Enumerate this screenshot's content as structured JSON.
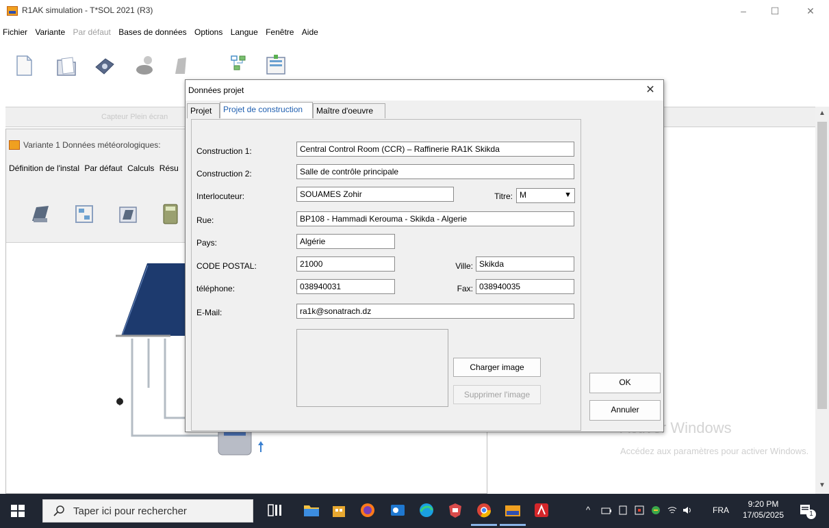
{
  "app": {
    "title": "R1AK simulation - T*SOL 2021 (R3)",
    "controls": {
      "minimize": "–",
      "maximize": "☐",
      "close": "✕"
    }
  },
  "menu": [
    "Fichier",
    "Variante",
    "Par défaut",
    "Bases de données",
    "Options",
    "Langue",
    "Fenêtre",
    "Aide"
  ],
  "menu_disabled": [
    "Par défaut"
  ],
  "strip_label": "Capteur Plein écran",
  "child_window": {
    "title": "Variante 1  Données météorologiques:",
    "menu": [
      "Définition de l'instal",
      "Par défaut",
      "Calculs",
      "Résu"
    ]
  },
  "watermark": {
    "title": "Activer Windows",
    "subtitle": "Accédez aux paramètres pour activer Windows."
  },
  "dialog": {
    "title": "Données projet",
    "close": "✕",
    "tabs": [
      "Projet",
      "Projet de construction",
      "Maître d'oeuvre"
    ],
    "active_tab": "Projet de construction",
    "form": {
      "construction1_label": "Construction 1:",
      "construction1_value": "Central Control Room (CCR) – Raffinerie RA1K Skikda",
      "construction2_label": "Construction 2:",
      "construction2_value": "Salle de contrôle principale",
      "interlocuteur_label": "Interlocuteur:",
      "interlocuteur_value": "SOUAMES Zohir",
      "titre_label": "Titre:",
      "titre_value": "M",
      "rue_label": "Rue:",
      "rue_value": "BP108 - Hammadi Kerouma - Skikda - Algerie",
      "pays_label": "Pays:",
      "pays_value": "Algérie",
      "code_postal_label": "CODE POSTAL:",
      "code_postal_value": "21000",
      "ville_label": "Ville:",
      "ville_value": "Skikda",
      "telephone_label": "téléphone:",
      "telephone_value": "038940031",
      "fax_label": "Fax:",
      "fax_value": "038940035",
      "email_label": "E-Mail:",
      "email_value": "ra1k@sonatrach.dz"
    },
    "buttons": {
      "load_image": "Charger image",
      "delete_image": "Supprimer l'image",
      "ok": "OK",
      "cancel": "Annuler"
    }
  },
  "taskbar": {
    "search_placeholder": "Taper ici pour rechercher",
    "language": "FRA",
    "time": "9:20 PM",
    "date": "17/05/2025",
    "notification_count": "1"
  },
  "colors": {
    "accent": "#1f5fb0",
    "taskbar": "#202632",
    "app_icon": "#f0a020"
  }
}
